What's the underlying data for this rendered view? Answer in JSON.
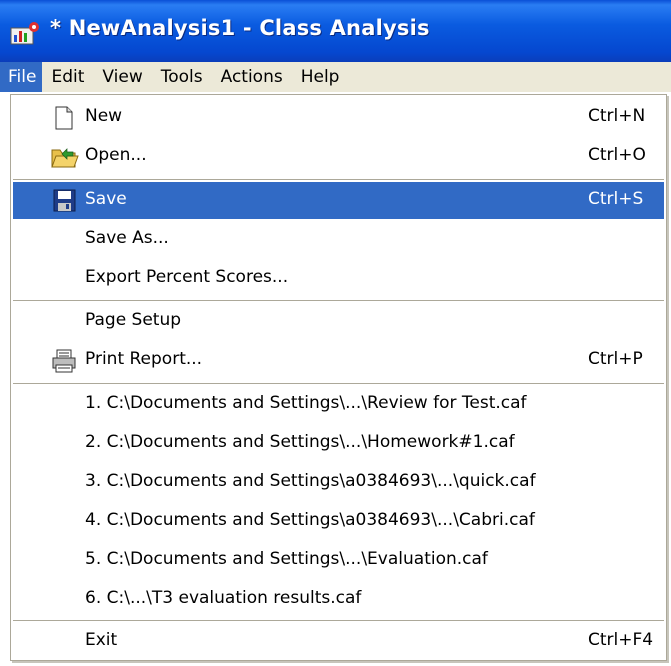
{
  "window": {
    "title": "* NewAnalysis1 - Class Analysis"
  },
  "menubar": {
    "items": [
      {
        "label": "File"
      },
      {
        "label": "Edit"
      },
      {
        "label": "View"
      },
      {
        "label": "Tools"
      },
      {
        "label": "Actions"
      },
      {
        "label": "Help"
      }
    ]
  },
  "file_menu": {
    "new": {
      "label": "New",
      "shortcut": "Ctrl+N",
      "icon": "new-document-icon"
    },
    "open": {
      "label": "Open...",
      "shortcut": "Ctrl+O",
      "icon": "open-folder-icon"
    },
    "save": {
      "label": "Save",
      "shortcut": "Ctrl+S",
      "icon": "floppy-disk-icon"
    },
    "save_as": {
      "label": "Save As..."
    },
    "export": {
      "label": "Export Percent Scores..."
    },
    "page_setup": {
      "label": "Page Setup"
    },
    "print": {
      "label": "Print Report...",
      "shortcut": "Ctrl+P",
      "icon": "printer-icon"
    },
    "recent": [
      "1. C:\\Documents and Settings\\...\\Review for Test.caf",
      "2. C:\\Documents and Settings\\...\\Homework#1.caf",
      "3. C:\\Documents and Settings\\a0384693\\...\\quick.caf",
      "4. C:\\Documents and Settings\\a0384693\\...\\Cabri.caf",
      "5. C:\\Documents and Settings\\...\\Evaluation.caf",
      "6. C:\\...\\T3 evaluation results.caf"
    ],
    "exit": {
      "label": "Exit",
      "shortcut": "Ctrl+F4"
    }
  },
  "colors": {
    "highlight": "#316ac5",
    "titlebar": "#0a5be0",
    "menubar": "#ece9d8"
  }
}
